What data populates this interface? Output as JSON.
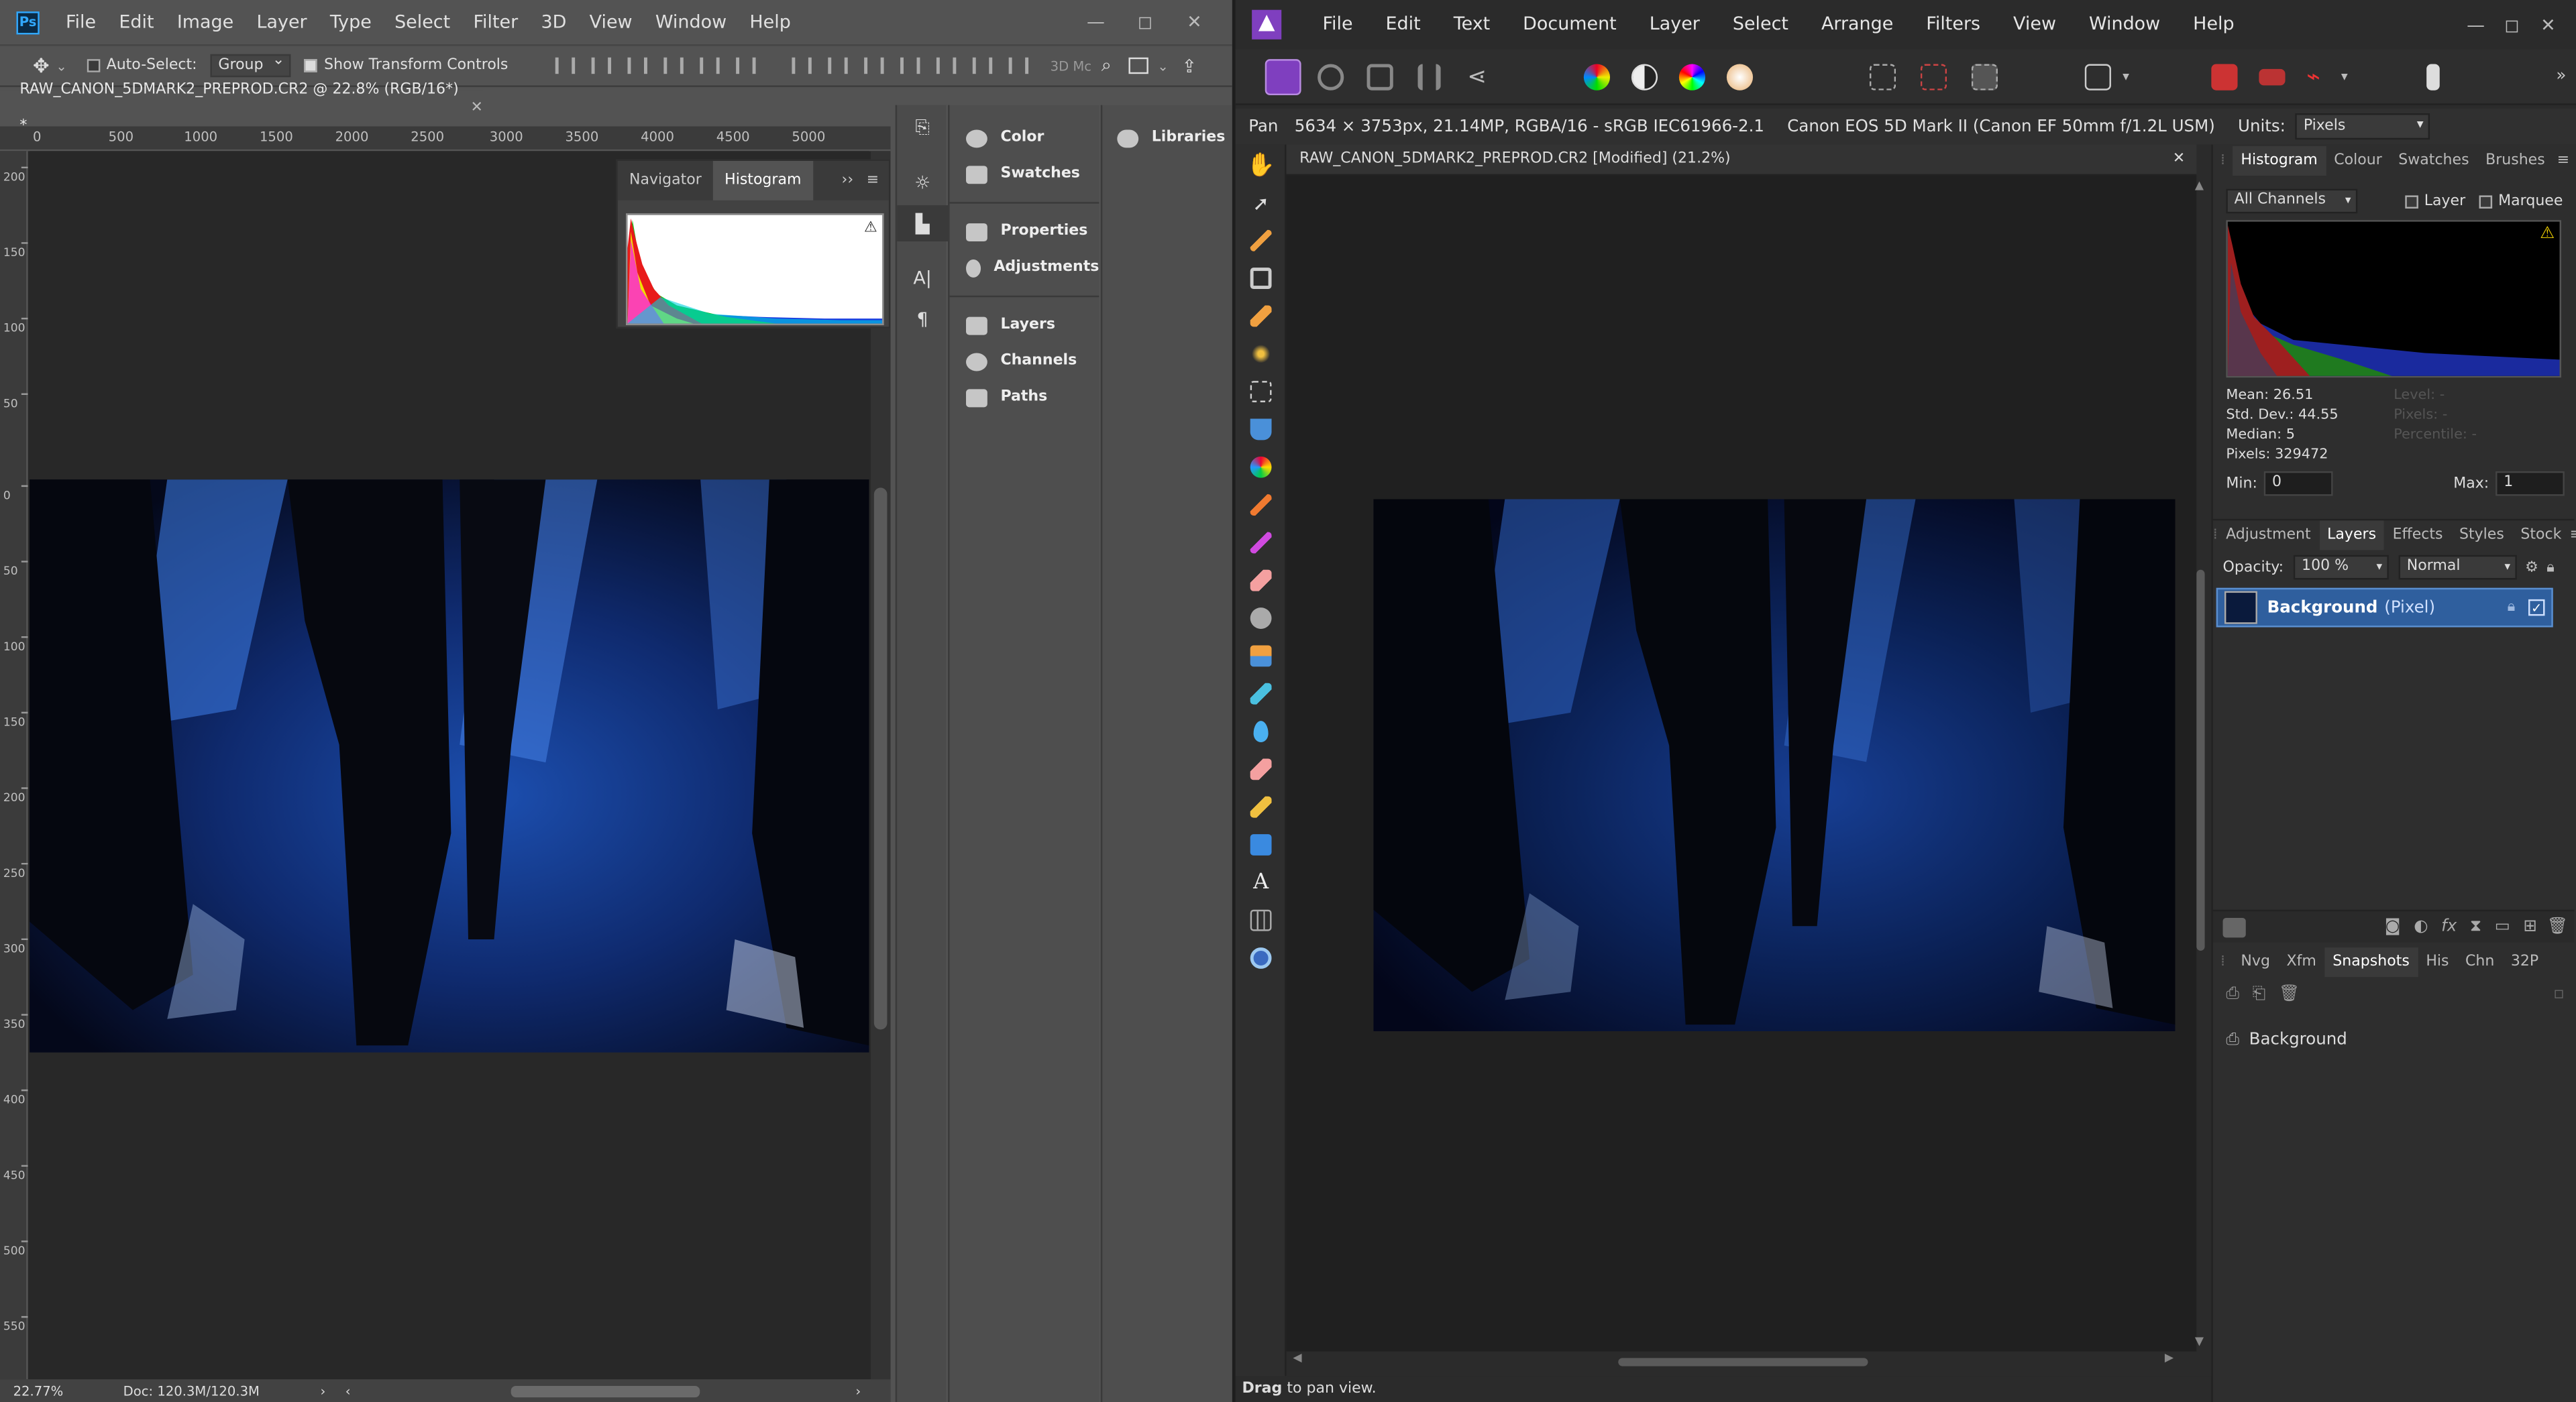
{
  "photoshop": {
    "logo_text": "Ps",
    "menu": [
      "File",
      "Edit",
      "Image",
      "Layer",
      "Type",
      "Select",
      "Filter",
      "3D",
      "View",
      "Window",
      "Help"
    ],
    "window_controls": [
      "—",
      "◻",
      "✕"
    ],
    "options": {
      "auto_select_label": "Auto-Select:",
      "group_value": "Group",
      "show_transform_label": "Show Transform Controls",
      "mode_3d_label": "3D Mc"
    },
    "doc_tab": "RAW_CANON_5DMARK2_PREPROD.CR2 @ 22.8% (RGB/16*) *",
    "ruler_h": [
      "0",
      "500",
      "1000",
      "1500",
      "2000",
      "2500",
      "3000",
      "3500",
      "4000",
      "4500",
      "5000"
    ],
    "ruler_v": [
      "200",
      "150",
      "100",
      "50",
      "0",
      "50",
      "100",
      "150",
      "200",
      "250",
      "300",
      "350",
      "400",
      "450",
      "500",
      "550"
    ],
    "histogram_panel": {
      "tabs": [
        "Navigator",
        "Histogram"
      ],
      "active_tab": "Histogram"
    },
    "panels": [
      {
        "group": [
          {
            "label": "Color",
            "icon": "color-icon"
          },
          {
            "label": "Swatches",
            "icon": "swatches-icon"
          }
        ]
      },
      {
        "group": [
          {
            "label": "Properties",
            "icon": "properties-icon"
          },
          {
            "label": "Adjustments",
            "icon": "adjustments-icon"
          }
        ]
      },
      {
        "group": [
          {
            "label": "Layers",
            "icon": "layers-icon"
          },
          {
            "label": "Channels",
            "icon": "channels-icon"
          },
          {
            "label": "Paths",
            "icon": "paths-icon"
          }
        ]
      }
    ],
    "libraries_label": "Libraries",
    "status": {
      "zoom": "22.77%",
      "doc": "Doc: 120.3M/120.3M"
    }
  },
  "affinity": {
    "menu": [
      "File",
      "Edit",
      "Text",
      "Document",
      "Layer",
      "Select",
      "Arrange",
      "Filters",
      "View",
      "Window",
      "Help"
    ],
    "window_controls": [
      "—",
      "◻",
      "✕"
    ],
    "ctx": {
      "tool": "Pan",
      "info": "5634 × 3753px, 21.14MP, RGBA/16 - sRGB IEC61966-2.1",
      "camera": "Canon EOS 5D Mark II (Canon EF 50mm f/1.2L USM)",
      "units_label": "Units:",
      "units_value": "Pixels"
    },
    "doc_tab": "RAW_CANON_5DMARK2_PREPROD.CR2 [Modified] (21.2%)",
    "status": {
      "bold": "Drag",
      "rest": "to pan view."
    },
    "histogram_panel": {
      "tabs": [
        "Histogram",
        "Colour",
        "Swatches",
        "Brushes"
      ],
      "active_tab": "Histogram",
      "channel": "All Channels",
      "layer_label": "Layer",
      "marquee_label": "Marquee",
      "stats": [
        "Mean: 26.51",
        "Std. Dev.: 44.55",
        "Median: 5",
        "Pixels: 329472"
      ],
      "stats_dim": [
        "Level: -",
        "Pixels: -",
        "Percentile: -"
      ],
      "min_label": "Min:",
      "min_value": "0",
      "max_label": "Max:",
      "max_value": "1"
    },
    "layers_panel": {
      "tabs": [
        "Adjustment",
        "Layers",
        "Effects",
        "Styles",
        "Stock"
      ],
      "active_tab": "Layers",
      "opacity_label": "Opacity:",
      "opacity_value": "100 %",
      "blend_value": "Normal",
      "layer_name": "Background",
      "layer_type": "(Pixel)"
    },
    "snapshots_panel": {
      "tabs": [
        "Nvg",
        "Xfm",
        "Snapshots",
        "His",
        "Chn",
        "32P"
      ],
      "active_tab": "Snapshots",
      "item": "Background"
    }
  },
  "colors": {
    "ps_bg": "#535353",
    "af_bg": "#2b2b2b",
    "af_accent": "#7f3fbf",
    "selection_blue": "#2f5f9e"
  }
}
